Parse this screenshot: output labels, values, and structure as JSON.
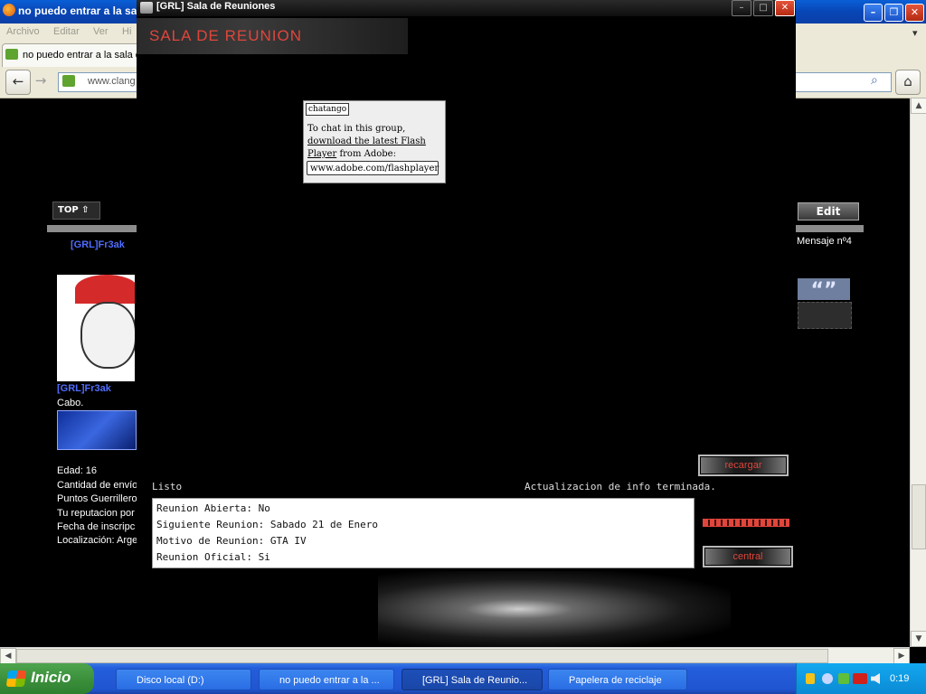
{
  "browser": {
    "title": "no puedo entrar a la sa",
    "menu": [
      "Archivo",
      "Editar",
      "Ver",
      "Hi"
    ],
    "tab_label": "no puedo entrar a la sala d",
    "url": "www.clang"
  },
  "page": {
    "top_label": "TOP",
    "username": "[GRL]Fr3ak",
    "user_rank_name": "[GRL]Fr3ak",
    "rank": "Cabo.",
    "profile": [
      "Edad: 16",
      "Cantidad de envío",
      "Puntos Guerrillero",
      "Tu reputacion por",
      "Fecha de inscripc",
      "Localización: Arge"
    ],
    "edit_label": "Edit",
    "message_number": "Mensaje nº4"
  },
  "chat_window": {
    "title": "[GRL] Sala de Reuniones",
    "banner": "SALA DE REUNION",
    "flash": {
      "logo": "chatango",
      "line1": "To chat in this group,",
      "link": "download the latest Flash Player",
      "line2": "from Adobe:",
      "url": "www.adobe.com/flashplayer"
    },
    "status_left": "Listo",
    "status_right": "Actualizacion de info terminada.",
    "info": [
      "Reunion Abierta: No",
      "Siguiente Reunion: Sabado 21 de Enero",
      "Motivo de Reunion: GTA IV",
      "Reunion Oficial: Si"
    ],
    "btn_reload": "recargar",
    "btn_central": "central"
  },
  "taskbar": {
    "start": "Inicio",
    "items": [
      "Disco local (D:)",
      "no puedo entrar a la ...",
      "[GRL] Sala de Reunio...",
      "Papelera de reciclaje"
    ],
    "clock": "0:19"
  },
  "colors": {
    "accent_red": "#e0463c",
    "xp_blue": "#245edc"
  }
}
